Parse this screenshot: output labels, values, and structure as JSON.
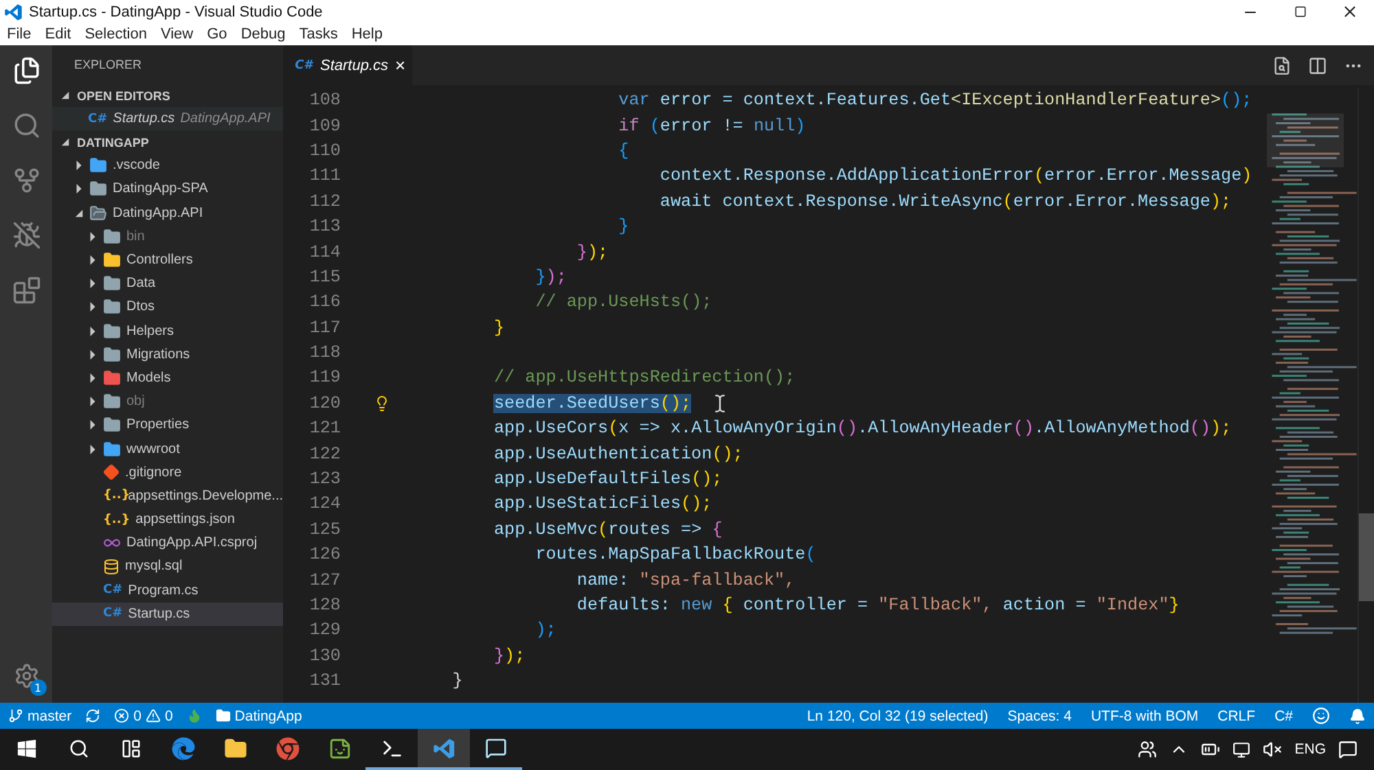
{
  "window": {
    "title": "Startup.cs - DatingApp - Visual Studio Code"
  },
  "menu": [
    "File",
    "Edit",
    "Selection",
    "View",
    "Go",
    "Debug",
    "Tasks",
    "Help"
  ],
  "activity_bar": {
    "settings_badge": "1"
  },
  "sidebar": {
    "title": "EXPLORER",
    "open_editors": {
      "title": "OPEN EDITORS",
      "items": [
        {
          "glyph": "C#",
          "label": "Startup.cs",
          "description": "DatingApp.API"
        }
      ]
    },
    "folder": {
      "title": "DATINGAPP",
      "items": [
        {
          "label": ".vscode",
          "kind": "vscode",
          "expanded": false,
          "dimmed": false,
          "selected": false
        },
        {
          "label": "DatingApp-SPA",
          "kind": "folder",
          "expanded": false,
          "dimmed": false,
          "selected": false
        },
        {
          "label": "DatingApp.API",
          "kind": "folder",
          "expanded": true,
          "dimmed": false,
          "selected": false,
          "children": [
            {
              "label": "bin",
              "kind": "folder",
              "expanded": false,
              "dimmed": true,
              "selected": false
            },
            {
              "label": "Controllers",
              "kind": "controllers",
              "expanded": false,
              "dimmed": false,
              "selected": false
            },
            {
              "label": "Data",
              "kind": "folder",
              "expanded": false,
              "dimmed": false,
              "selected": false
            },
            {
              "label": "Dtos",
              "kind": "folder",
              "expanded": false,
              "dimmed": false,
              "selected": false
            },
            {
              "label": "Helpers",
              "kind": "folder",
              "expanded": false,
              "dimmed": false,
              "selected": false
            },
            {
              "label": "Migrations",
              "kind": "folder",
              "expanded": false,
              "dimmed": false,
              "selected": false
            },
            {
              "label": "Models",
              "kind": "models",
              "expanded": false,
              "dimmed": false,
              "selected": false
            },
            {
              "label": "obj",
              "kind": "folder",
              "expanded": false,
              "dimmed": true,
              "selected": false
            },
            {
              "label": "Properties",
              "kind": "folder",
              "expanded": false,
              "dimmed": false,
              "selected": false
            },
            {
              "label": "wwwroot",
              "kind": "web",
              "expanded": false,
              "dimmed": false,
              "selected": false
            },
            {
              "label": ".gitignore",
              "kind": "git",
              "dimmed": false,
              "selected": false
            },
            {
              "label": "appsettings.Developme...",
              "kind": "json",
              "glyph": "{..}",
              "dimmed": false,
              "selected": false
            },
            {
              "label": "appsettings.json",
              "kind": "json",
              "glyph": "{..}",
              "dimmed": false,
              "selected": false
            },
            {
              "label": "DatingApp.API.csproj",
              "kind": "csproj",
              "dimmed": false,
              "selected": false
            },
            {
              "label": "mysql.sql",
              "kind": "sql",
              "dimmed": false,
              "selected": false
            },
            {
              "label": "Program.cs",
              "kind": "cs",
              "glyph": "C#",
              "dimmed": false,
              "selected": false
            },
            {
              "label": "Startup.cs",
              "kind": "cs",
              "glyph": "C#",
              "dimmed": false,
              "selected": true
            }
          ]
        }
      ]
    }
  },
  "tabs": [
    {
      "glyph": "C#",
      "label": "Startup.cs",
      "close": "×",
      "selected": true
    }
  ],
  "editor": {
    "lines": [
      {
        "number": "108",
        "selected": false,
        "lightbulb": false,
        "tokens": [
          {
            "text": "                    var",
            "kind": "k"
          },
          {
            "text": " error = context.Features.Get",
            "kind": "v"
          },
          {
            "text": "<IExceptionHandlerFeature>",
            "kind": "t"
          },
          {
            "text": "();",
            "kind": "b3"
          }
        ]
      },
      {
        "number": "109",
        "selected": false,
        "lightbulb": false,
        "tokens": [
          {
            "text": "                    if",
            "kind": "c"
          },
          {
            "text": " (",
            "kind": "b3"
          },
          {
            "text": "error != ",
            "kind": "v"
          },
          {
            "text": "null",
            "kind": "k"
          },
          {
            "text": ")",
            "kind": "b3"
          }
        ]
      },
      {
        "number": "110",
        "selected": false,
        "lightbulb": false,
        "tokens": [
          {
            "text": "                    {",
            "kind": "b3"
          }
        ]
      },
      {
        "number": "111",
        "selected": false,
        "lightbulb": false,
        "tokens": [
          {
            "text": "                        context.Response.AddApplicationError",
            "kind": "v"
          },
          {
            "text": "(",
            "kind": "b1"
          },
          {
            "text": "error.Error.Message",
            "kind": "v"
          },
          {
            "text": ")",
            "kind": "b1"
          }
        ]
      },
      {
        "number": "112",
        "selected": false,
        "lightbulb": false,
        "tokens": [
          {
            "text": "                        await context.Response.WriteAsync",
            "kind": "v"
          },
          {
            "text": "(",
            "kind": "b1"
          },
          {
            "text": "error.Error.Message",
            "kind": "v"
          },
          {
            "text": ");",
            "kind": "b1"
          }
        ]
      },
      {
        "number": "113",
        "selected": false,
        "lightbulb": false,
        "tokens": [
          {
            "text": "                    }",
            "kind": "b3"
          }
        ]
      },
      {
        "number": "114",
        "selected": false,
        "lightbulb": false,
        "tokens": [
          {
            "text": "                }",
            "kind": "b2"
          },
          {
            "text": ");",
            "kind": "b1"
          }
        ]
      },
      {
        "number": "115",
        "selected": false,
        "lightbulb": false,
        "tokens": [
          {
            "text": "            }",
            "kind": "b3"
          },
          {
            "text": ");",
            "kind": "b2"
          }
        ]
      },
      {
        "number": "116",
        "selected": false,
        "lightbulb": false,
        "tokens": [
          {
            "text": "            // app.UseHsts();",
            "kind": "m"
          }
        ]
      },
      {
        "number": "117",
        "selected": false,
        "lightbulb": false,
        "tokens": [
          {
            "text": "        }",
            "kind": "b1"
          }
        ]
      },
      {
        "number": "118",
        "selected": false,
        "lightbulb": false
      },
      {
        "number": "119",
        "selected": false,
        "lightbulb": false,
        "tokens": [
          {
            "text": "        // app.UseHttpsRedirection();",
            "kind": "m"
          }
        ]
      },
      {
        "number": "120",
        "selected": true,
        "lightbulb": true,
        "tokens": [
          {
            "text": "        seeder.SeedUsers",
            "kind": "v"
          },
          {
            "text": "();",
            "kind": "b1"
          }
        ]
      },
      {
        "number": "121",
        "selected": false,
        "lightbulb": false,
        "tokens": [
          {
            "text": "        app.UseCors",
            "kind": "v"
          },
          {
            "text": "(",
            "kind": "b1"
          },
          {
            "text": "x => x.AllowAnyOrigin",
            "kind": "v"
          },
          {
            "text": "()",
            "kind": "b2"
          },
          {
            "text": ".AllowAnyHeader",
            "kind": "v"
          },
          {
            "text": "()",
            "kind": "b2"
          },
          {
            "text": ".AllowAnyMethod",
            "kind": "v"
          },
          {
            "text": "()",
            "kind": "b2"
          },
          {
            "text": ");",
            "kind": "b1"
          }
        ]
      },
      {
        "number": "122",
        "selected": false,
        "lightbulb": false,
        "tokens": [
          {
            "text": "        app.UseAuthentication",
            "kind": "v"
          },
          {
            "text": "();",
            "kind": "b1"
          }
        ]
      },
      {
        "number": "123",
        "selected": false,
        "lightbulb": false,
        "tokens": [
          {
            "text": "        app.UseDefaultFiles",
            "kind": "v"
          },
          {
            "text": "();",
            "kind": "b1"
          }
        ]
      },
      {
        "number": "124",
        "selected": false,
        "lightbulb": false,
        "tokens": [
          {
            "text": "        app.UseStaticFiles",
            "kind": "v"
          },
          {
            "text": "();",
            "kind": "b1"
          }
        ]
      },
      {
        "number": "125",
        "selected": false,
        "lightbulb": false,
        "tokens": [
          {
            "text": "        app.UseMvc",
            "kind": "v"
          },
          {
            "text": "(",
            "kind": "b1"
          },
          {
            "text": "routes => ",
            "kind": "v"
          },
          {
            "text": "{",
            "kind": "b2"
          }
        ]
      },
      {
        "number": "126",
        "selected": false,
        "lightbulb": false,
        "tokens": [
          {
            "text": "            routes.MapSpaFallbackRoute",
            "kind": "v"
          },
          {
            "text": "(",
            "kind": "b3"
          }
        ]
      },
      {
        "number": "127",
        "selected": false,
        "lightbulb": false,
        "tokens": [
          {
            "text": "                name: ",
            "kind": "v"
          },
          {
            "text": "\"spa-fallback\",",
            "kind": "s"
          }
        ]
      },
      {
        "number": "128",
        "selected": false,
        "lightbulb": false,
        "tokens": [
          {
            "text": "                defaults: ",
            "kind": "v"
          },
          {
            "text": "new",
            "kind": "k"
          },
          {
            "text": " {",
            "kind": "b1"
          },
          {
            "text": " controller = ",
            "kind": "v"
          },
          {
            "text": "\"Fallback\", ",
            "kind": "s"
          },
          {
            "text": "action = ",
            "kind": "v"
          },
          {
            "text": "\"Index\"",
            "kind": "s"
          },
          {
            "text": "}",
            "kind": "b1"
          }
        ]
      },
      {
        "number": "129",
        "selected": false,
        "lightbulb": false,
        "tokens": [
          {
            "text": "            );",
            "kind": "b3"
          }
        ]
      },
      {
        "number": "130",
        "selected": false,
        "lightbulb": false,
        "tokens": [
          {
            "text": "        }",
            "kind": "b2"
          },
          {
            "text": ");",
            "kind": "b1"
          }
        ]
      },
      {
        "number": "131",
        "selected": false,
        "lightbulb": false,
        "tokens": [
          {
            "text": "    }",
            "kind": "p"
          }
        ]
      }
    ]
  },
  "status_bar": {
    "branch": "master",
    "errors": "0",
    "warnings": "0",
    "folder": "DatingApp",
    "position": "Ln 120, Col 32 (19 selected)",
    "indent": "Spaces: 4",
    "encoding": "UTF-8 with BOM",
    "eol": "CRLF",
    "language": "C#"
  },
  "taskbar": {
    "language": "ENG"
  }
}
